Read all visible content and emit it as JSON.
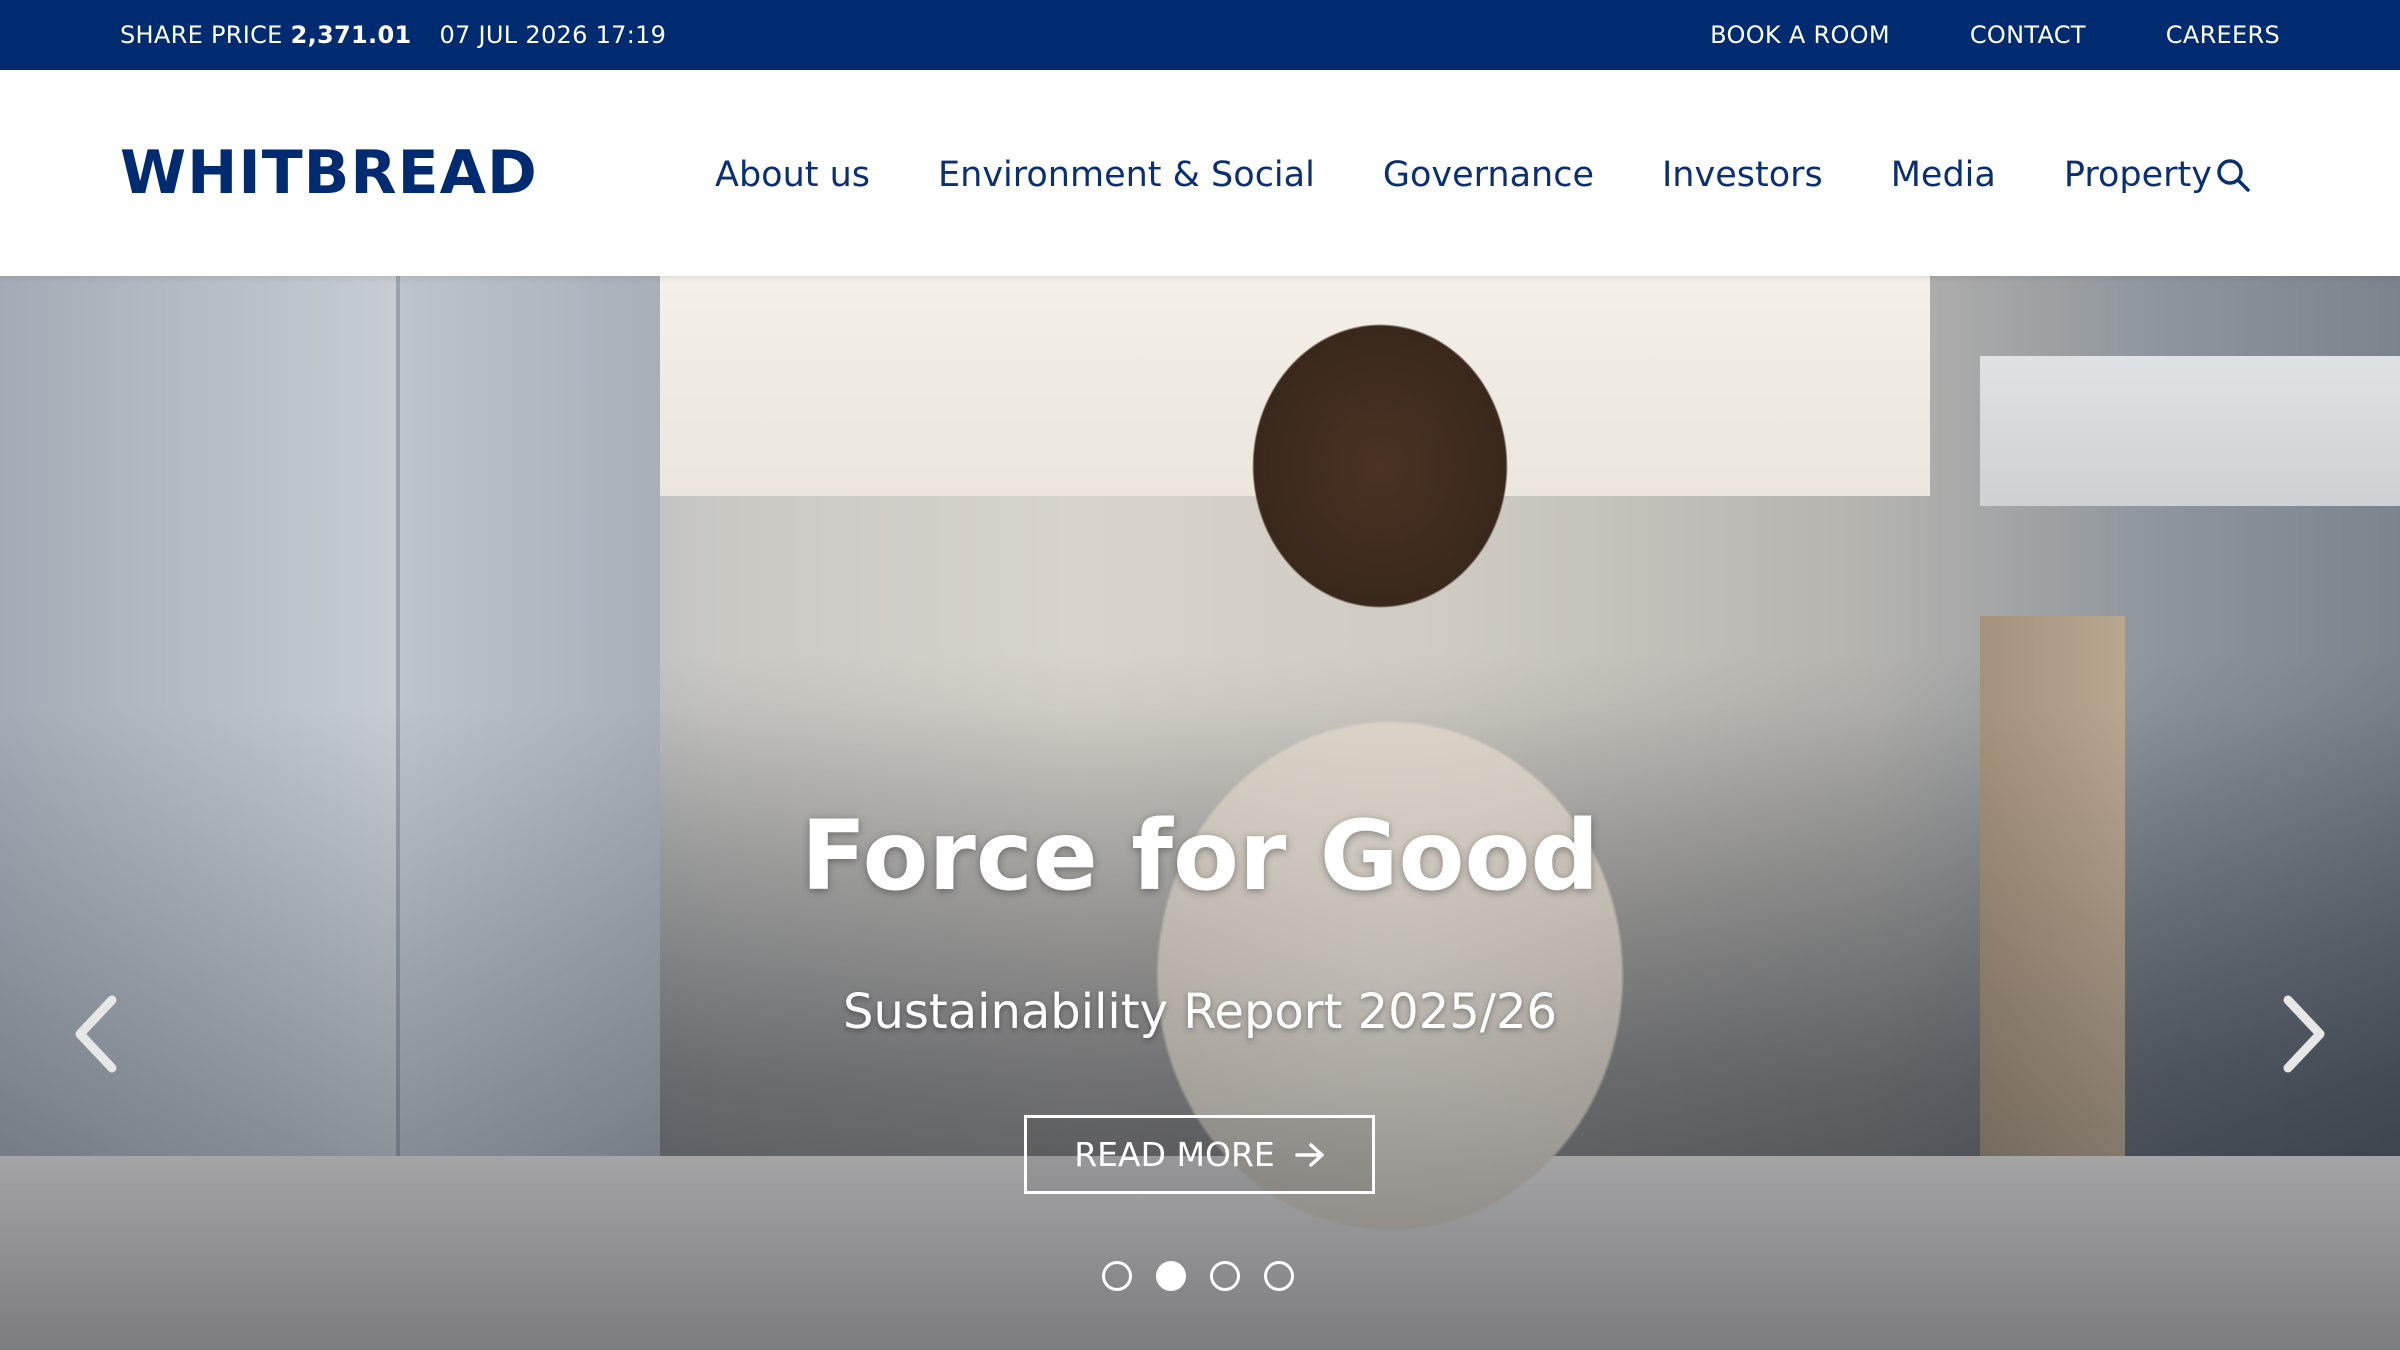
{
  "topbar": {
    "share_price_label": "SHARE PRICE",
    "share_price_value": "2,371.01",
    "datetime": "07 JUL 2026 17:19",
    "links": [
      "BOOK A ROOM",
      "CONTACT",
      "CAREERS"
    ]
  },
  "header": {
    "logo_text": "WHITBREAD",
    "nav": [
      "About us",
      "Environment & Social",
      "Governance",
      "Investors",
      "Media",
      "Property"
    ],
    "search_icon": "search-icon"
  },
  "hero": {
    "title": "Force for Good",
    "subtitle": "Sustainability Report 2025/26",
    "cta_label": "READ MORE",
    "cta_icon": "arrow-right-icon",
    "prev_icon": "chevron-left-icon",
    "next_icon": "chevron-right-icon",
    "slides_total": 4,
    "active_slide": 2
  },
  "colors": {
    "brand_navy": "#002b71",
    "nav_text": "#0b2f73",
    "white": "#ffffff"
  }
}
